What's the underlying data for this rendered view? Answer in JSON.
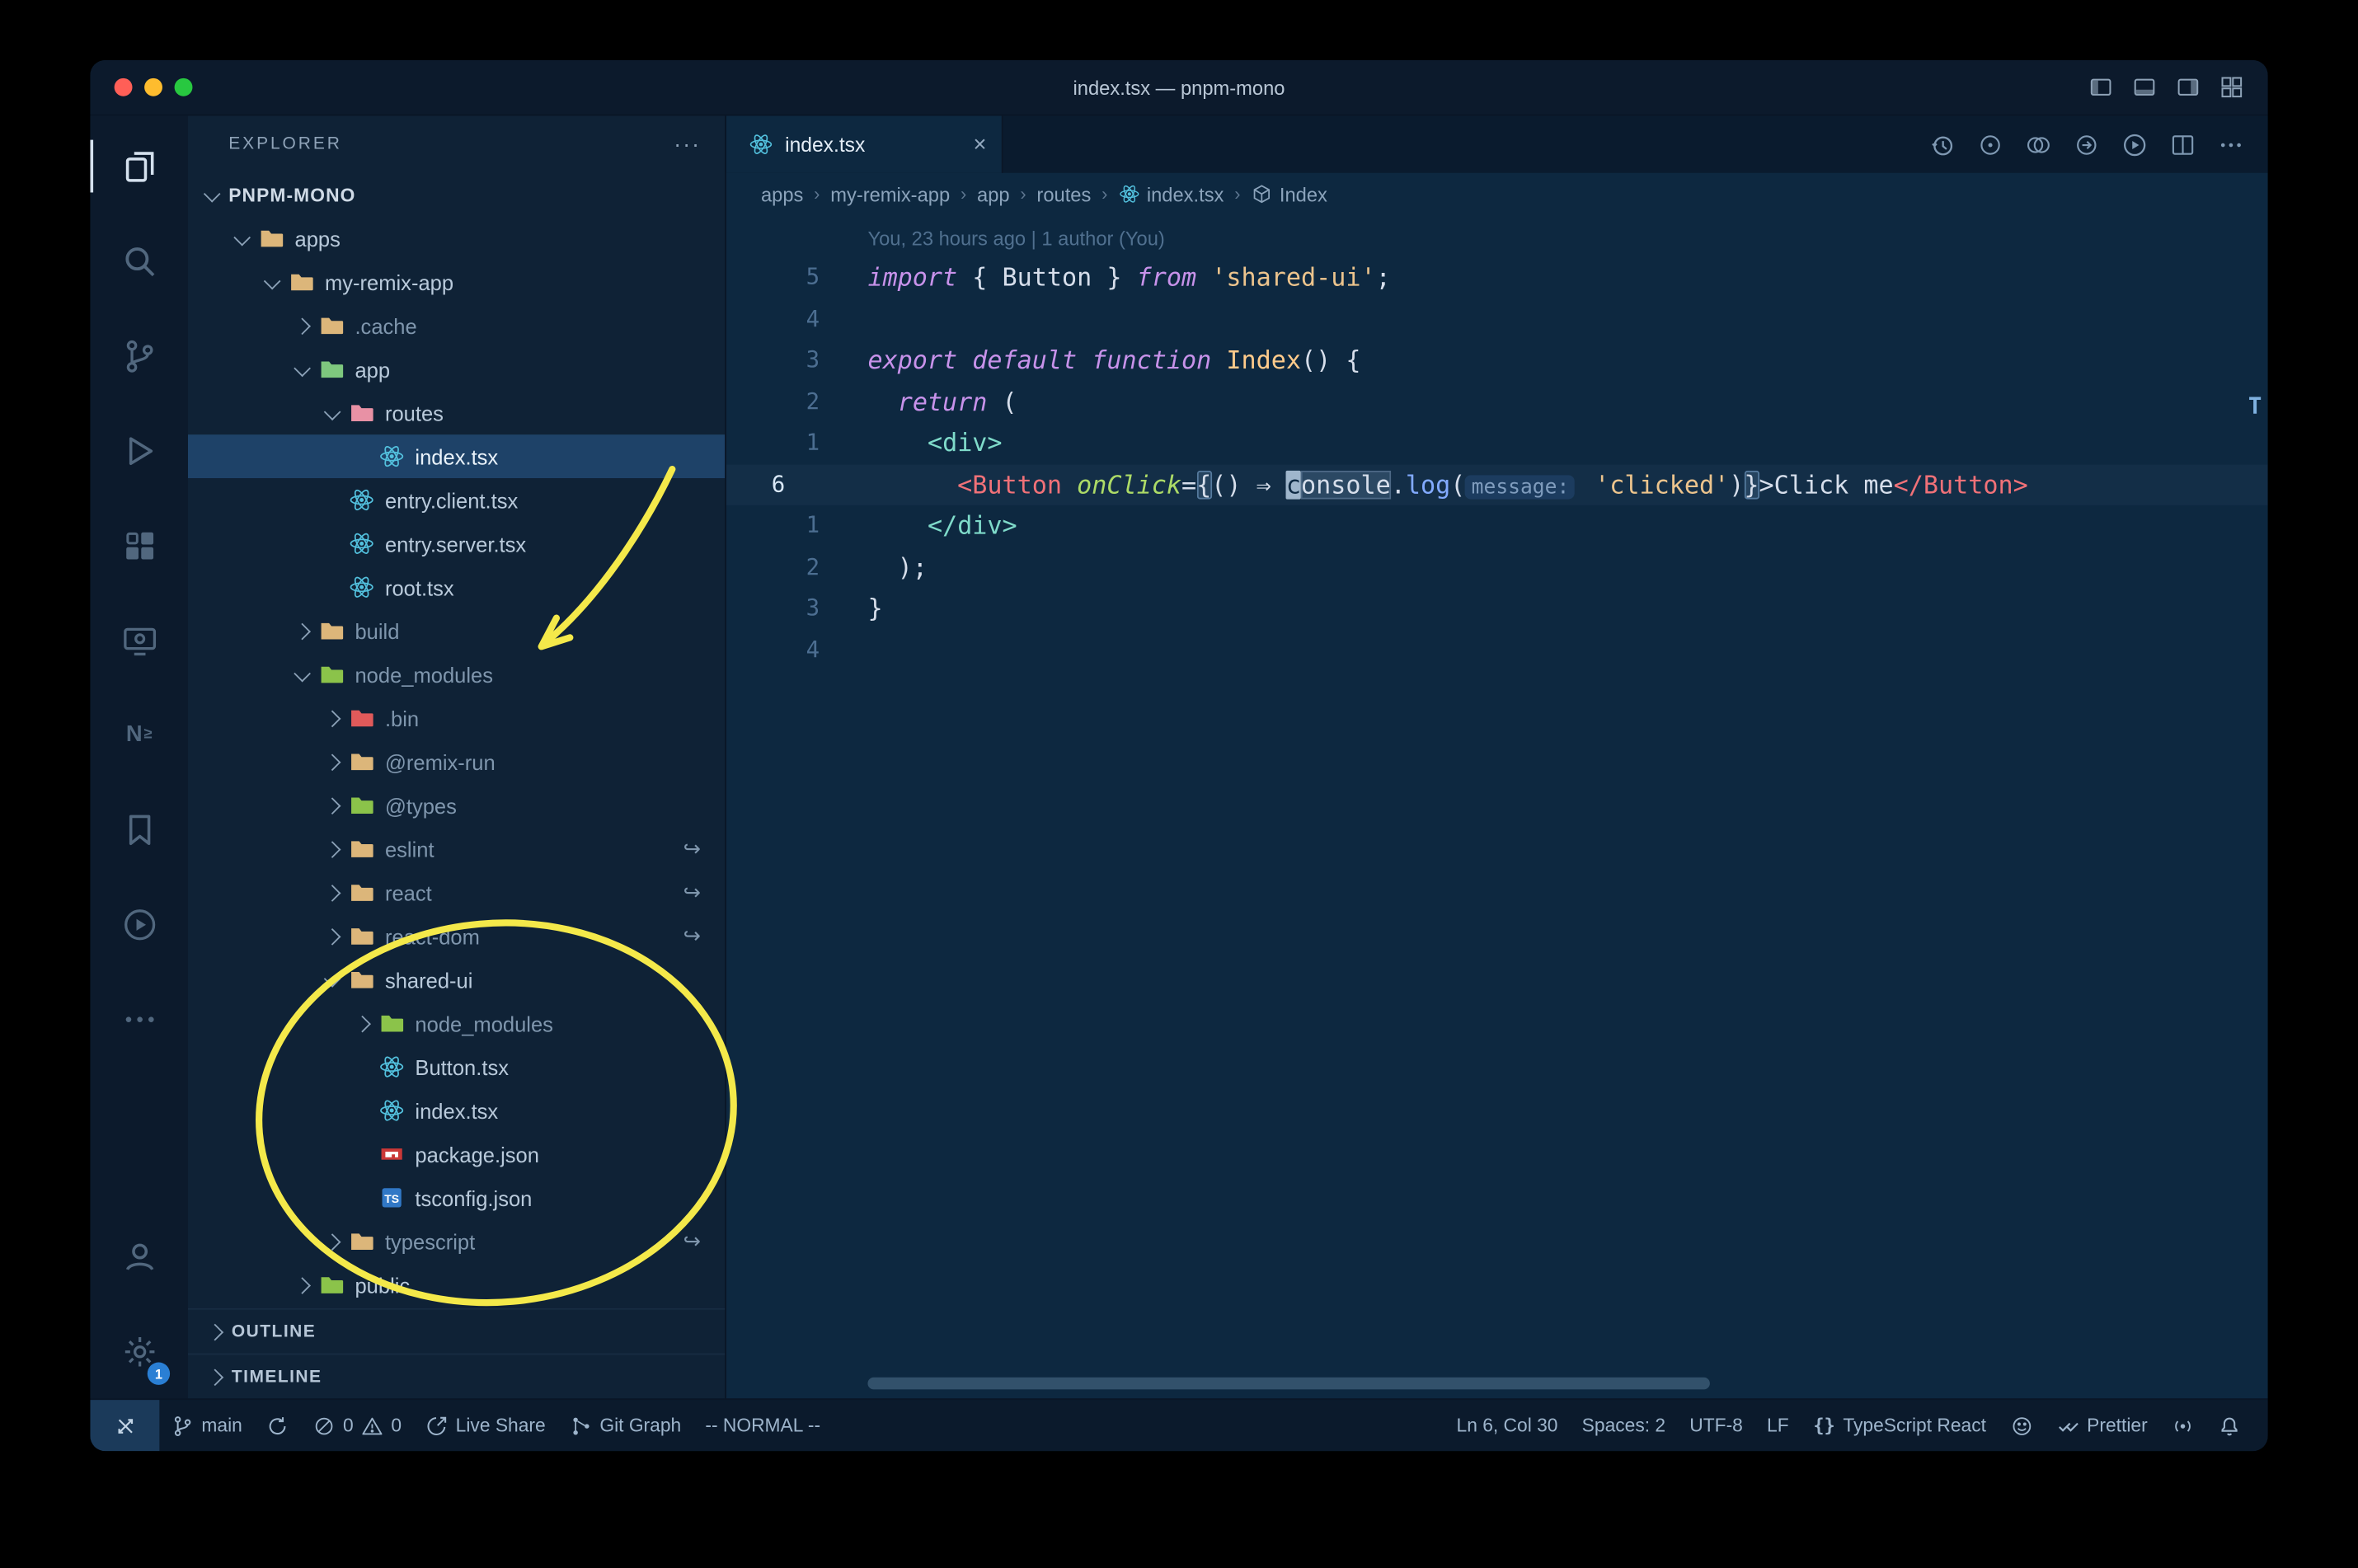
{
  "titlebar": {
    "title": "index.tsx — pnpm-mono",
    "window_controls": [
      {
        "name": "close",
        "color": "#ff5f57"
      },
      {
        "name": "minimize",
        "color": "#febc2e"
      },
      {
        "name": "zoom",
        "color": "#28c840"
      }
    ],
    "layout_controls": [
      {
        "name": "toggle-primary-sidebar",
        "icon": "layoutL"
      },
      {
        "name": "toggle-panel",
        "icon": "layoutB"
      },
      {
        "name": "toggle-secondary-sidebar",
        "icon": "layoutR"
      },
      {
        "name": "customize-layout",
        "icon": "layoutGrid"
      }
    ]
  },
  "activity_bar": {
    "top": [
      {
        "name": "explorer",
        "icon": "files",
        "active": true
      },
      {
        "name": "search",
        "icon": "search"
      },
      {
        "name": "source-control",
        "icon": "scm"
      },
      {
        "name": "run-and-debug",
        "icon": "debug"
      },
      {
        "name": "extensions",
        "icon": "ext"
      },
      {
        "name": "remote-explorer",
        "icon": "remote"
      },
      {
        "name": "nx-console",
        "icon": "nx"
      },
      {
        "name": "bookmarks",
        "icon": "bookmark"
      },
      {
        "name": "code-runner",
        "icon": "playcircle"
      },
      {
        "name": "additional-views",
        "icon": "more"
      }
    ],
    "bottom": [
      {
        "name": "accounts",
        "icon": "account"
      },
      {
        "name": "settings",
        "icon": "gear",
        "badge": "1"
      }
    ]
  },
  "sidebar": {
    "title": "EXPLORER",
    "more_label": "···",
    "tree": [
      {
        "label": "PNPM-MONO",
        "depth": 0,
        "chevron": "down",
        "bold": true
      },
      {
        "label": "apps",
        "depth": 1,
        "chevron": "down",
        "icon": "folder",
        "color": "#dcb67a"
      },
      {
        "label": "my-remix-app",
        "depth": 2,
        "chevron": "down",
        "icon": "folder",
        "color": "#dcb67a"
      },
      {
        "label": ".cache",
        "depth": 3,
        "chevron": "right",
        "icon": "folder",
        "color": "#dcb67a",
        "dim": true
      },
      {
        "label": "app",
        "depth": 3,
        "chevron": "down",
        "icon": "folder",
        "color": "#7ec87e"
      },
      {
        "label": "routes",
        "depth": 4,
        "chevron": "down",
        "icon": "folder",
        "color": "#e891a5"
      },
      {
        "label": "index.tsx",
        "depth": 5,
        "icon": "react",
        "selected": true
      },
      {
        "label": "entry.client.tsx",
        "depth": 4,
        "icon": "react"
      },
      {
        "label": "entry.server.tsx",
        "depth": 4,
        "icon": "react"
      },
      {
        "label": "root.tsx",
        "depth": 4,
        "icon": "react"
      },
      {
        "label": "build",
        "depth": 3,
        "chevron": "right",
        "icon": "folder",
        "color": "#dcb67a",
        "dim": true
      },
      {
        "label": "node_modules",
        "depth": 3,
        "chevron": "down",
        "icon": "folder",
        "color": "#8bc34a",
        "dim": true
      },
      {
        "label": ".bin",
        "depth": 4,
        "chevron": "right",
        "icon": "folder",
        "color": "#e05a5a",
        "dim": true
      },
      {
        "label": "@remix-run",
        "depth": 4,
        "chevron": "right",
        "icon": "folder",
        "color": "#dcb67a",
        "dim": true
      },
      {
        "label": "@types",
        "depth": 4,
        "chevron": "right",
        "icon": "folder",
        "color": "#8bc34a",
        "dim": true
      },
      {
        "label": "eslint",
        "depth": 4,
        "chevron": "right",
        "icon": "folder",
        "color": "#dcb67a",
        "dim": true,
        "symlink": true
      },
      {
        "label": "react",
        "depth": 4,
        "chevron": "right",
        "icon": "folder",
        "color": "#dcb67a",
        "dim": true,
        "symlink": true
      },
      {
        "label": "react-dom",
        "depth": 4,
        "chevron": "right",
        "icon": "folder",
        "color": "#dcb67a",
        "dim": true,
        "symlink": true
      },
      {
        "label": "shared-ui",
        "depth": 4,
        "chevron": "down",
        "icon": "folder",
        "color": "#dcb67a"
      },
      {
        "label": "node_modules",
        "depth": 5,
        "chevron": "right",
        "icon": "folder",
        "color": "#8bc34a",
        "dim": true
      },
      {
        "label": "Button.tsx",
        "depth": 5,
        "icon": "react"
      },
      {
        "label": "index.tsx",
        "depth": 5,
        "icon": "react"
      },
      {
        "label": "package.json",
        "depth": 5,
        "icon": "npm"
      },
      {
        "label": "tsconfig.json",
        "depth": 5,
        "icon": "ts"
      },
      {
        "label": "typescript",
        "depth": 4,
        "chevron": "right",
        "icon": "folder",
        "color": "#dcb67a",
        "dim": true,
        "symlink": true
      },
      {
        "label": "public",
        "depth": 3,
        "chevron": "right",
        "icon": "folder",
        "color": "#8bc34a"
      }
    ],
    "sections": [
      {
        "label": "OUTLINE"
      },
      {
        "label": "TIMELINE"
      }
    ]
  },
  "editor": {
    "tab": {
      "label": "index.tsx",
      "close": "×"
    },
    "actions": [
      {
        "name": "local-history",
        "icon": "history"
      },
      {
        "name": "gitlens-annotations",
        "icon": "circledot"
      },
      {
        "name": "gitlens-compare",
        "icon": "circles"
      },
      {
        "name": "open-changes",
        "icon": "circlearrow"
      },
      {
        "name": "run-file",
        "icon": "playcircle"
      },
      {
        "name": "split-editor",
        "icon": "split"
      },
      {
        "name": "more-actions",
        "icon": "more"
      }
    ],
    "breadcrumbs": [
      {
        "label": "apps"
      },
      {
        "label": "my-remix-app"
      },
      {
        "label": "app"
      },
      {
        "label": "routes"
      },
      {
        "label": "index.tsx",
        "icon": "react"
      },
      {
        "label": "Index",
        "icon": "symbol"
      }
    ],
    "blame": "You, 23 hours ago | 1 author (You)",
    "overview_mark": "T",
    "code": [
      {
        "n": "5",
        "segs": [
          [
            "import",
            "kw"
          ],
          [
            " { ",
            "pl"
          ],
          [
            "Button",
            "pl"
          ],
          [
            " } ",
            "pl"
          ],
          [
            "from",
            "kw"
          ],
          [
            " ",
            "pl"
          ],
          [
            "'shared-ui'",
            "str"
          ],
          [
            ";",
            "pl"
          ]
        ]
      },
      {
        "n": "4",
        "segs": []
      },
      {
        "n": "3",
        "segs": [
          [
            "export",
            "kw"
          ],
          [
            " ",
            "pl"
          ],
          [
            "default",
            "kw"
          ],
          [
            " ",
            "pl"
          ],
          [
            "function",
            "kw"
          ],
          [
            " ",
            "pl"
          ],
          [
            "Index",
            "fn"
          ],
          [
            "() {",
            "pl"
          ]
        ]
      },
      {
        "n": "2",
        "segs": [
          [
            "  ",
            "pl"
          ],
          [
            "return",
            "kw"
          ],
          [
            " (",
            "pl"
          ]
        ]
      },
      {
        "n": "1",
        "segs": [
          [
            "    ",
            "pl"
          ],
          [
            "<div>",
            "tagt"
          ]
        ]
      },
      {
        "n": "6",
        "current": true,
        "segs": [
          [
            "      ",
            "pl"
          ],
          [
            "<Button",
            "tagc"
          ],
          [
            " ",
            "pl"
          ],
          [
            "onClick",
            "attr"
          ],
          [
            "=",
            "pl"
          ],
          [
            "{",
            "brhl"
          ],
          [
            "()",
            "pl"
          ],
          [
            " ⇒ ",
            "pl"
          ],
          [
            "c",
            "cur"
          ],
          [
            "onsole",
            "whl"
          ],
          [
            ".",
            "pl"
          ],
          [
            "log",
            "meth"
          ],
          [
            "(",
            "pl"
          ],
          [
            "message:",
            "inlay"
          ],
          [
            " ",
            "pl"
          ],
          [
            "'clicked'",
            "str"
          ],
          [
            ")",
            "pl"
          ],
          [
            "}",
            "brhl"
          ],
          [
            ">",
            "pl"
          ],
          [
            "Click me",
            "pl"
          ],
          [
            "</Button>",
            "tagc"
          ]
        ]
      },
      {
        "n": "1",
        "segs": [
          [
            "    ",
            "pl"
          ],
          [
            "</div>",
            "tagt"
          ]
        ]
      },
      {
        "n": "2",
        "segs": [
          [
            "  );",
            "pl"
          ]
        ]
      },
      {
        "n": "3",
        "segs": [
          [
            "}",
            "pl"
          ]
        ]
      },
      {
        "n": "4",
        "segs": []
      }
    ]
  },
  "status_bar": {
    "left": [
      {
        "name": "remote-indicator",
        "icon": "remotex",
        "box": true
      },
      {
        "name": "git-branch",
        "icon": "branch",
        "label": "main"
      },
      {
        "name": "sync",
        "icon": "sync"
      },
      {
        "name": "problems",
        "parts": [
          {
            "icon": "error",
            "label": "0"
          },
          {
            "icon": "warning",
            "label": "0"
          }
        ]
      },
      {
        "name": "live-share",
        "icon": "liveshare",
        "label": "Live Share"
      },
      {
        "name": "git-graph",
        "icon": "gitgraph",
        "label": "Git Graph"
      },
      {
        "name": "vim-mode",
        "label": "-- NORMAL --"
      }
    ],
    "right": [
      {
        "name": "cursor-position",
        "label": "Ln 6, Col 30"
      },
      {
        "name": "indentation",
        "label": "Spaces: 2"
      },
      {
        "name": "encoding",
        "label": "UTF-8"
      },
      {
        "name": "eol",
        "label": "LF"
      },
      {
        "name": "language-mode",
        "icon": "braces",
        "label": "TypeScript React"
      },
      {
        "name": "feedback",
        "icon": "smiley"
      },
      {
        "name": "prettier",
        "icon": "checkdouble",
        "label": "Prettier"
      },
      {
        "name": "screencast",
        "icon": "broadcast"
      },
      {
        "name": "notifications",
        "icon": "bell"
      }
    ]
  },
  "annotation_color": "#f4e94a"
}
